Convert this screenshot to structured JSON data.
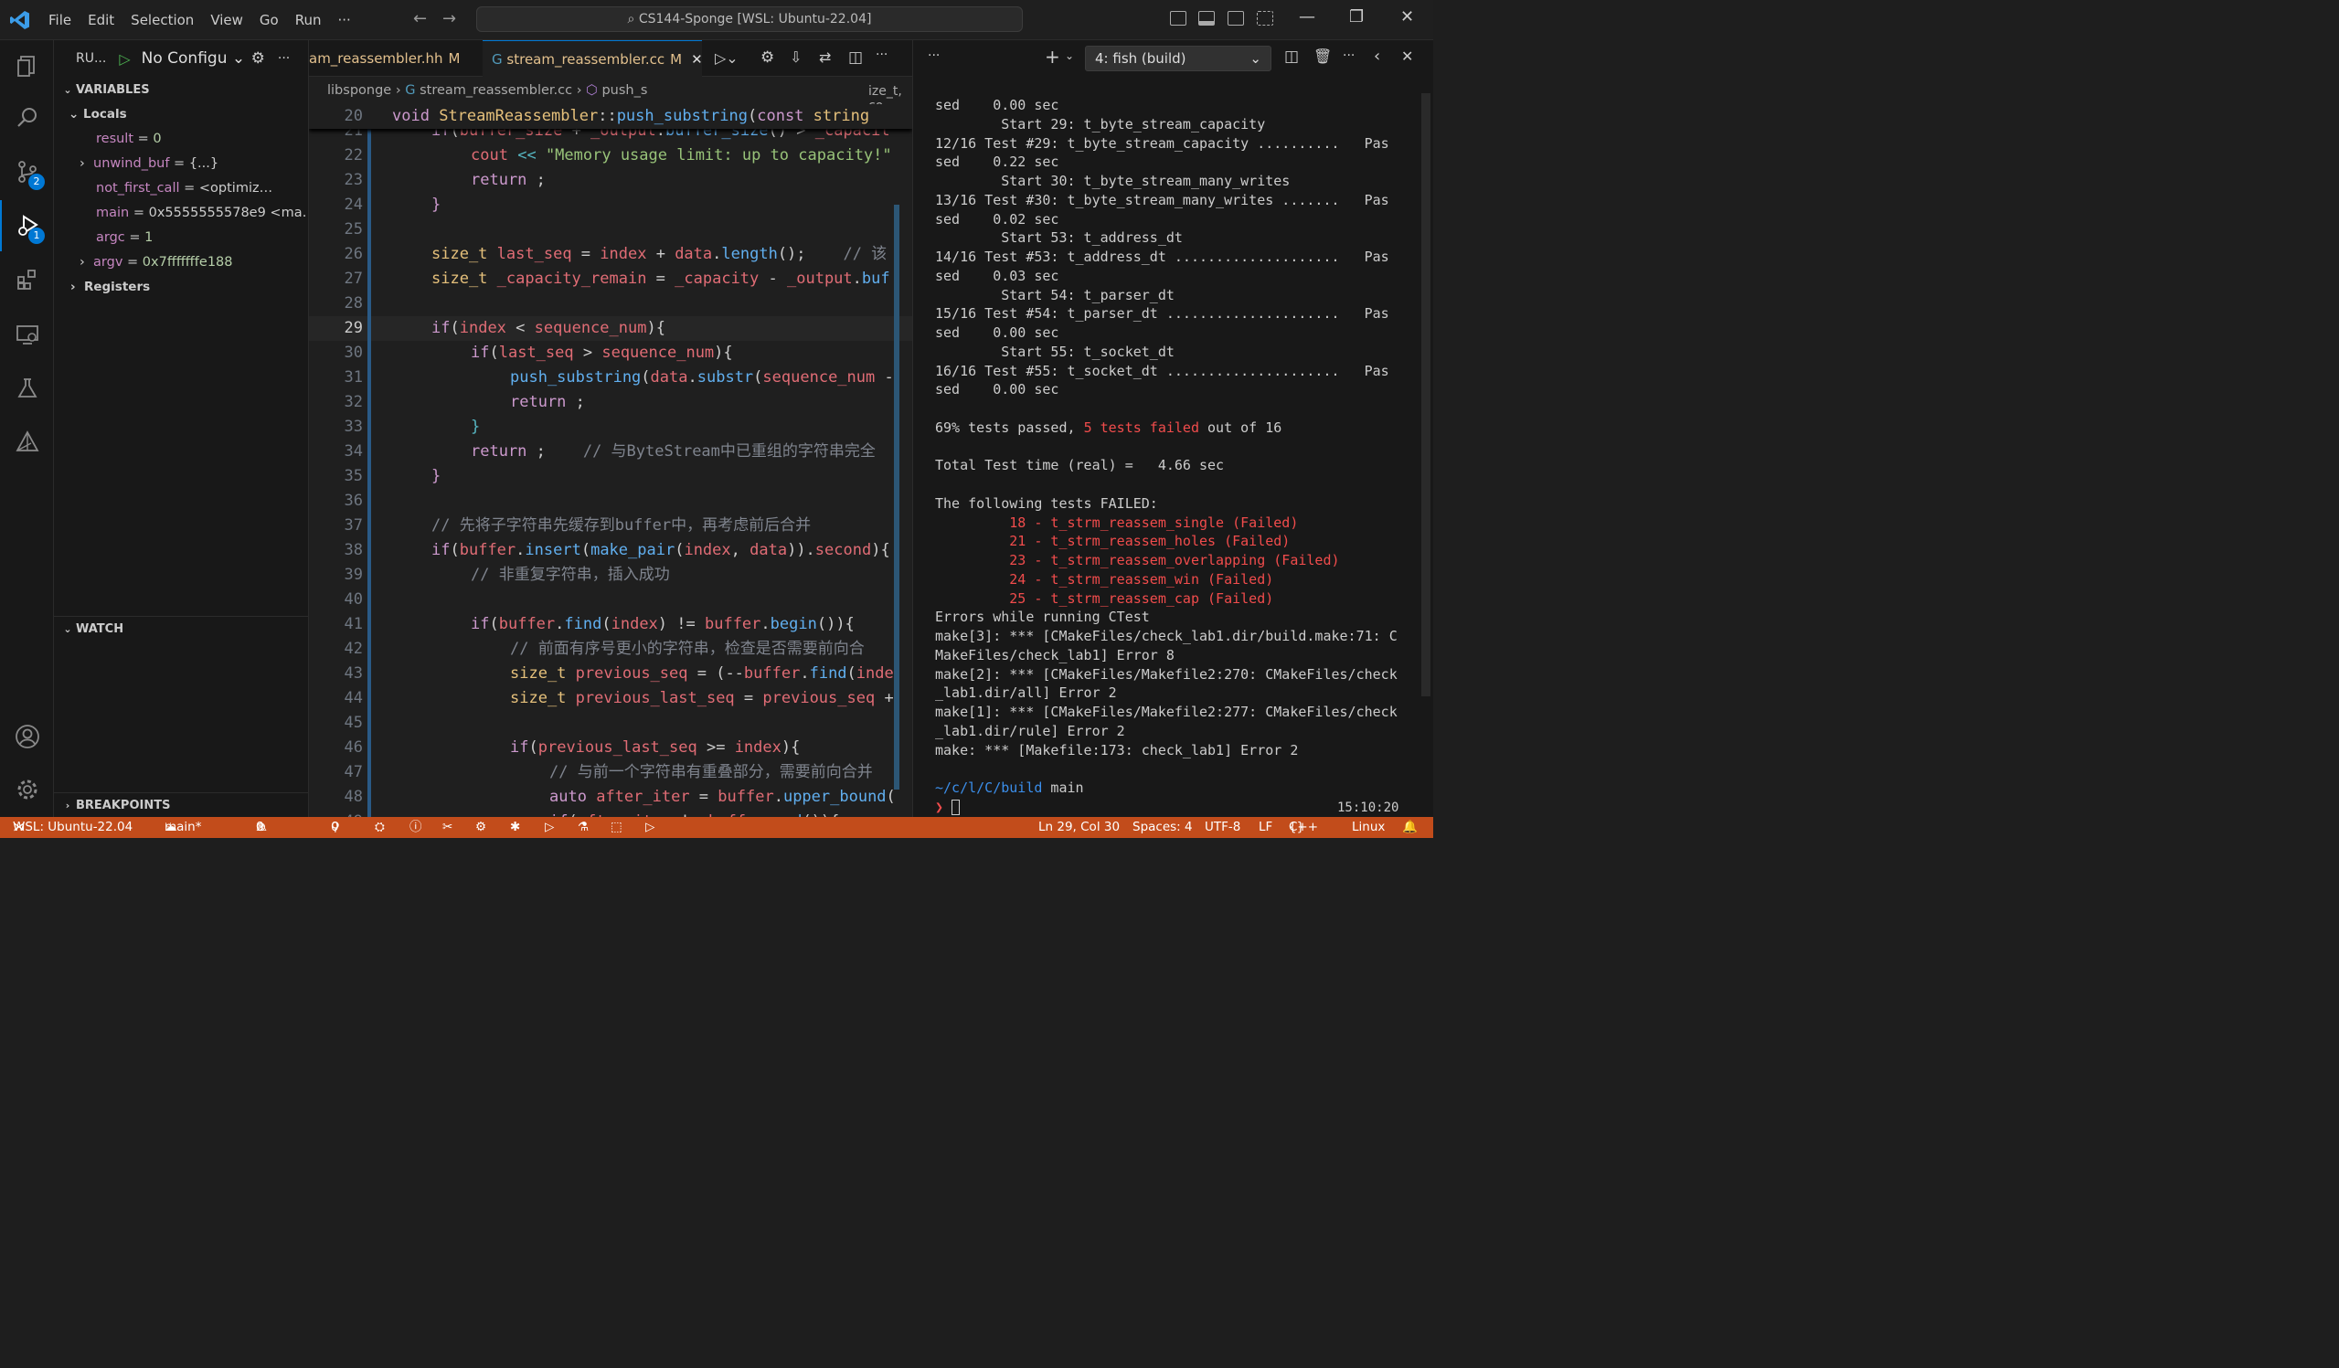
{
  "titlebar": {
    "menu": [
      "File",
      "Edit",
      "Selection",
      "View",
      "Go",
      "Run",
      "···"
    ],
    "search": "CS144-Sponge [WSL: Ubuntu-22.04]"
  },
  "activitybar": {
    "scm_badge": "2",
    "debug_badge": "1"
  },
  "sidebar": {
    "run_label": "RU...",
    "config": "No Configu",
    "variables_title": "VARIABLES",
    "locals_title": "Locals",
    "locals": [
      {
        "name": "result",
        "value": "0"
      },
      {
        "name": "unwind_buf",
        "value": "{...}"
      },
      {
        "name": "not_first_call",
        "value": "<optimiz…"
      },
      {
        "name": "main",
        "value": "0x5555555578e9 <ma…"
      },
      {
        "name": "argc",
        "value": "1"
      },
      {
        "name": "argv",
        "value": "0x7fffffffe188"
      }
    ],
    "registers": "Registers",
    "watch_title": "WATCH",
    "breakpoints_title": "BREAKPOINTS"
  },
  "editor": {
    "tabs": [
      {
        "name": "am_reassembler.hh",
        "status": "M"
      },
      {
        "name": "stream_reassembler.cc",
        "status": "M"
      }
    ],
    "breadcrumb": [
      "libsponge",
      "stream_reassembler.cc",
      "push_s"
    ],
    "breadcrumb_tail": "ize_t, co"
  },
  "terminal": {
    "selected": "4: fish (build)",
    "clock": "15:10:20",
    "lines": [
      "sed    0.00 sec",
      "        Start 29: t_byte_stream_capacity",
      "12/16 Test #29: t_byte_stream_capacity ..........   Pas",
      "sed    0.22 sec",
      "        Start 30: t_byte_stream_many_writes",
      "13/16 Test #30: t_byte_stream_many_writes .......   Pas",
      "sed    0.02 sec",
      "        Start 53: t_address_dt",
      "14/16 Test #53: t_address_dt ....................   Pas",
      "sed    0.03 sec",
      "        Start 54: t_parser_dt",
      "15/16 Test #54: t_parser_dt .....................   Pas",
      "sed    0.00 sec",
      "        Start 55: t_socket_dt",
      "16/16 Test #55: t_socket_dt .....................   Pas",
      "sed    0.00 sec",
      "",
      "69% tests passed, 5 tests failed out of 16",
      "",
      "Total Test time (real) =   4.66 sec",
      "",
      "The following tests FAILED:"
    ],
    "failed": [
      "\t 18 - t_strm_reassem_single (Failed)",
      "\t 21 - t_strm_reassem_holes (Failed)",
      "\t 23 - t_strm_reassem_overlapping (Failed)",
      "\t 24 - t_strm_reassem_win (Failed)",
      "\t 25 - t_strm_reassem_cap (Failed)"
    ],
    "errors": [
      "Errors while running CTest",
      "make[3]: *** [CMakeFiles/check_lab1.dir/build.make:71: C",
      "MakeFiles/check_lab1] Error 8",
      "make[2]: *** [CMakeFiles/Makefile2:270: CMakeFiles/check",
      "_lab1.dir/all] Error 2",
      "make[1]: *** [CMakeFiles/Makefile2:277: CMakeFiles/check",
      "_lab1.dir/rule] Error 2",
      "make: *** [Makefile:173: check_lab1] Error 2"
    ],
    "prompt_path": "~/c/l/C/build",
    "prompt_branch": " main"
  },
  "statusbar": {
    "remote": "WSL: Ubuntu-22.04",
    "branch": "main*",
    "errors": "0",
    "warnings": "0",
    "ports": "0",
    "position": "Ln 29, Col 30",
    "spaces": "Spaces: 4",
    "encoding": "UTF-8",
    "eol": "LF",
    "language": "C++",
    "platform": "Linux"
  },
  "colors": {
    "statusbar": "#c24c1b",
    "remote": "#16825d",
    "accent": "#0078d4"
  }
}
